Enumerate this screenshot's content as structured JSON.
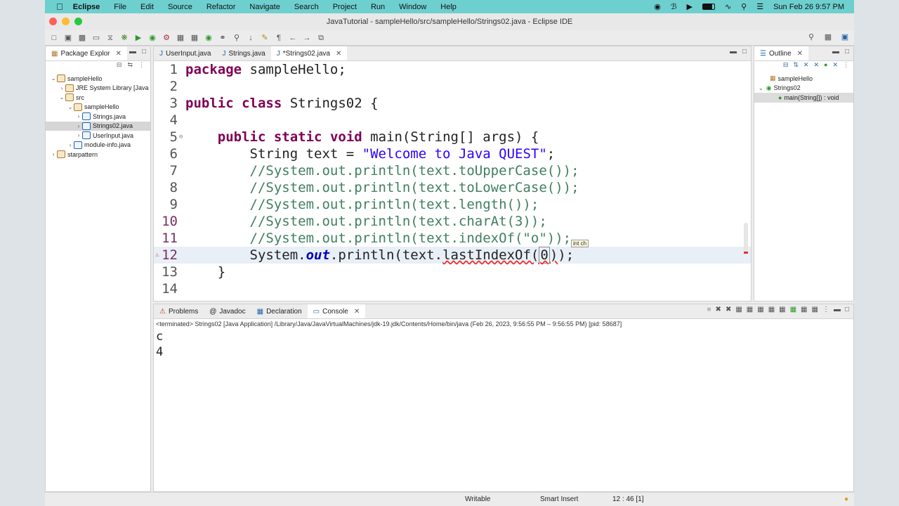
{
  "menubar": {
    "app": "Eclipse",
    "items": [
      "File",
      "Edit",
      "Source",
      "Refactor",
      "Navigate",
      "Search",
      "Project",
      "Run",
      "Window",
      "Help"
    ],
    "clock": "Sun Feb 26  9:57 PM"
  },
  "window": {
    "title": "JavaTutorial - sampleHello/src/sampleHello/Strings02.java - Eclipse IDE"
  },
  "package_explorer": {
    "tab_label": "Package Explor",
    "tree": [
      {
        "label": "sampleHello",
        "depth": 0,
        "expanded": true,
        "kind": "project"
      },
      {
        "label": "JRE System Library [Java",
        "depth": 1,
        "expanded": false,
        "kind": "library"
      },
      {
        "label": "src",
        "depth": 1,
        "expanded": true,
        "kind": "folder"
      },
      {
        "label": "sampleHello",
        "depth": 2,
        "expanded": true,
        "kind": "package"
      },
      {
        "label": "Strings.java",
        "depth": 3,
        "expanded": false,
        "kind": "file"
      },
      {
        "label": "Strings02.java",
        "depth": 3,
        "expanded": false,
        "kind": "file",
        "selected": true
      },
      {
        "label": "UserInput.java",
        "depth": 3,
        "expanded": false,
        "kind": "file"
      },
      {
        "label": "module-info.java",
        "depth": 2,
        "expanded": false,
        "kind": "file"
      },
      {
        "label": "starpattern",
        "depth": 0,
        "expanded": false,
        "kind": "project"
      }
    ]
  },
  "editor": {
    "tabs": [
      {
        "label": "UserInput.java",
        "active": false
      },
      {
        "label": "Strings.java",
        "active": false
      },
      {
        "label": "*Strings02.java",
        "active": true
      }
    ],
    "tooltip": "int ch"
  },
  "outline": {
    "tab_label": "Outline",
    "items": [
      "sampleHello",
      "Strings02",
      "main(String[]) : void"
    ]
  },
  "console": {
    "tabs": [
      "Problems",
      "Javadoc",
      "Declaration",
      "Console"
    ],
    "path": "<terminated> Strings02 [Java Application] /Library/Java/JavaVirtualMachines/jdk-19.jdk/Contents/Home/bin/java  (Feb 26, 2023, 9:56:55 PM – 9:56:55 PM) [pid: 58687]",
    "output": [
      "c",
      "4"
    ]
  },
  "statusbar": {
    "writable": "Writable",
    "insert_mode": "Smart Insert",
    "position": "12 : 46 [1]"
  },
  "colors": {
    "menubar_bg": "#6ecfcf",
    "keyword": "#7f0055",
    "string": "#2a00ff",
    "comment": "#3f7f5f",
    "field": "#0000c0"
  }
}
